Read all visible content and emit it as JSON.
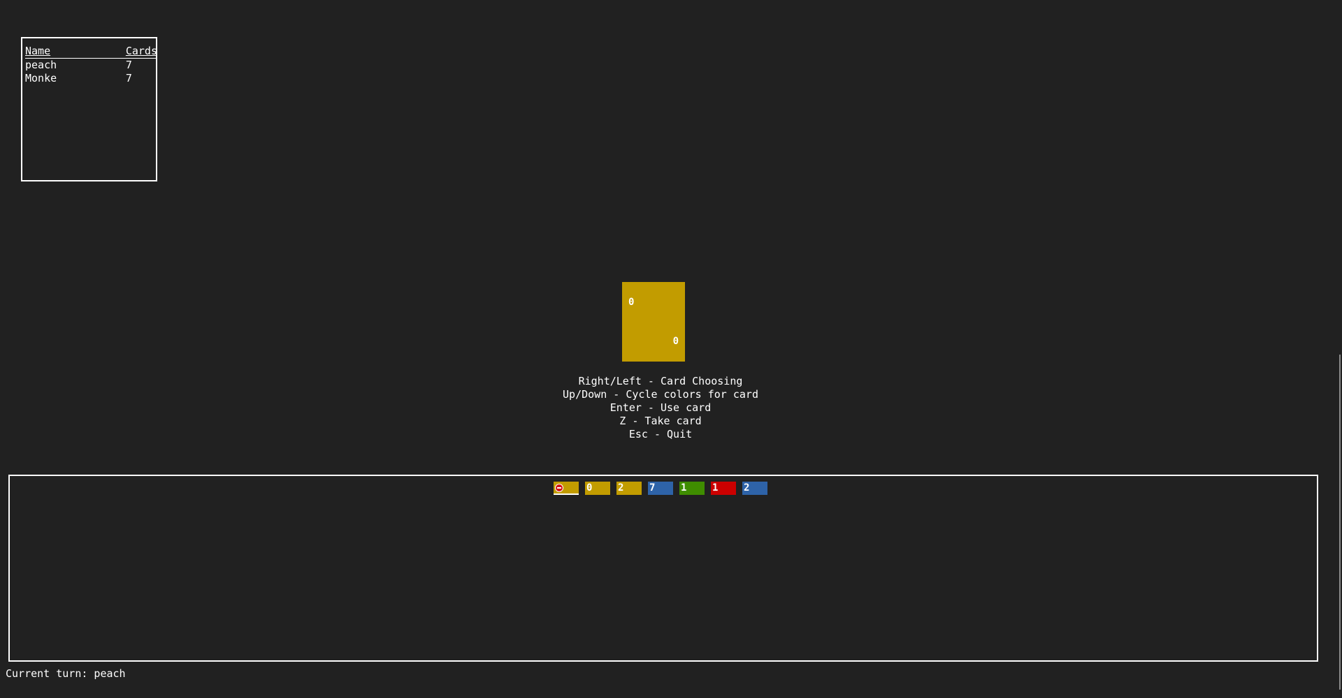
{
  "players": {
    "headers": {
      "name": "Name",
      "cards": "Cards"
    },
    "rows": [
      {
        "name": "peach",
        "cards": "7"
      },
      {
        "name": "Monke",
        "cards": "7"
      }
    ]
  },
  "top_card": {
    "value": "0",
    "color": "#c29c00"
  },
  "help": {
    "lines": [
      "Right/Left - Card Choosing",
      "Up/Down - Cycle colors for card",
      "Enter - Use card",
      "Z - Take card",
      "Esc - Quit"
    ]
  },
  "hand": {
    "selected_index": 0,
    "cards": [
      {
        "label": "",
        "icon": "skip-icon",
        "color": "#c29c00"
      },
      {
        "label": "0",
        "color": "#c29c00"
      },
      {
        "label": "2",
        "color": "#c29c00"
      },
      {
        "label": "7",
        "color": "#2e63a8"
      },
      {
        "label": "1",
        "color": "#3f8d00"
      },
      {
        "label": "1",
        "color": "#cc0000"
      },
      {
        "label": "2",
        "color": "#2e63a8"
      }
    ]
  },
  "status": {
    "text": "Current turn: peach"
  }
}
